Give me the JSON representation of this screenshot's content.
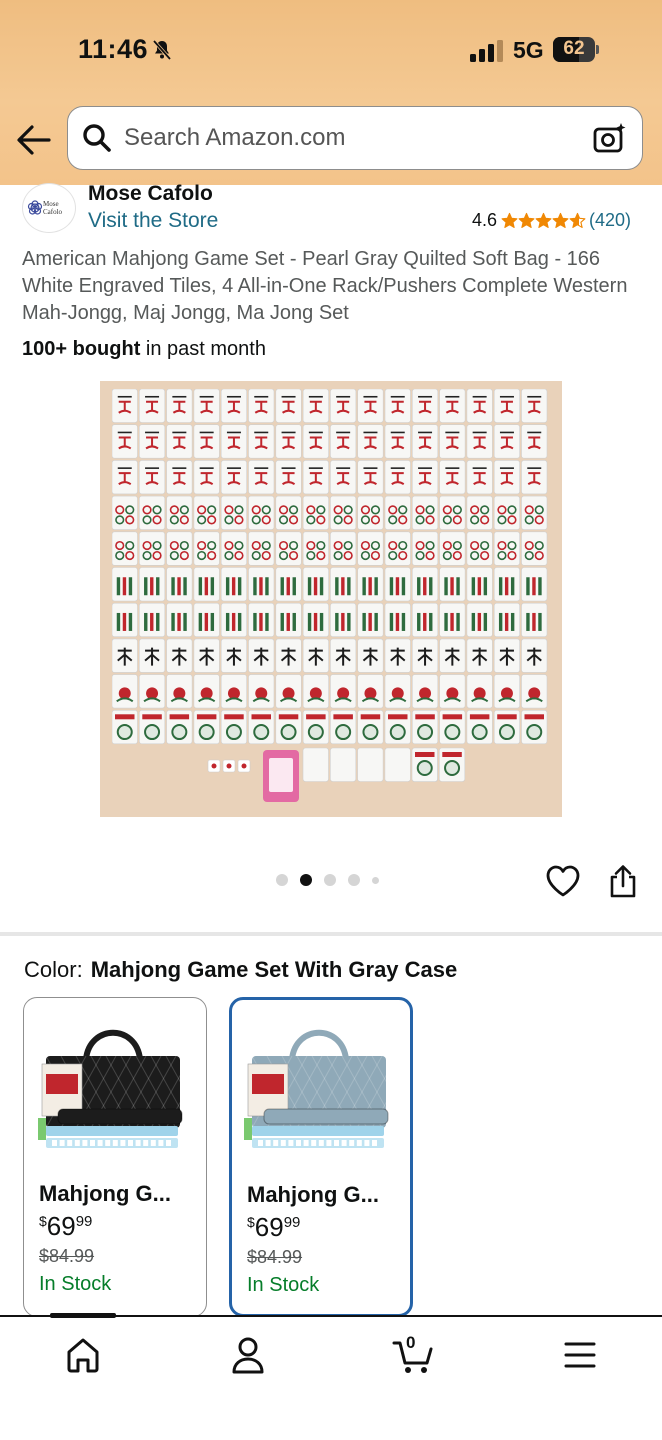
{
  "status_bar": {
    "time": "11:46",
    "network": "5G",
    "battery": "62",
    "battery_level": 0.62
  },
  "search": {
    "placeholder": "Search Amazon.com"
  },
  "store": {
    "brand": "Mose Cafolo",
    "logo_text": "Mose Cafolo",
    "visit_label": "Visit the Store",
    "rating": "4.6",
    "stars_value": 4.6,
    "review_count": "(420)"
  },
  "product": {
    "title": "American Mahjong Game Set - Pearl Gray Quilted Soft Bag - 166 White Engraved Tiles, 4 All-in-One Rack/Pushers Complete Western Mah-Jongg, Maj Jongg, Ma Jong Set",
    "bought_bold": "100+ bought",
    "bought_rest": " in past month",
    "image_count": 5,
    "image_index": 2
  },
  "variations": {
    "label": "Color:",
    "selected": "Mahjong Game Set With Gray Case",
    "items": [
      {
        "name": "Mahjong G...",
        "currency": "$",
        "price_whole": "69",
        "price_cents": "99",
        "list_price": "$84.99",
        "stock": "In Stock",
        "case_color": "#1c1c1c",
        "selected": false
      },
      {
        "name": "Mahjong G...",
        "currency": "$",
        "price_whole": "69",
        "price_cents": "99",
        "list_price": "$84.99",
        "stock": "In Stock",
        "case_color": "#8fa9b8",
        "selected": true
      }
    ]
  },
  "bottom_nav": {
    "items": [
      "home-icon",
      "account-icon",
      "cart-icon",
      "menu-icon"
    ],
    "cart_count": "0"
  },
  "colors": {
    "header_bg": "#f3c38a",
    "link": "#1f6b86",
    "star": "#f08804",
    "in_stock": "#067d2a",
    "selected_border": "#2563a8"
  }
}
